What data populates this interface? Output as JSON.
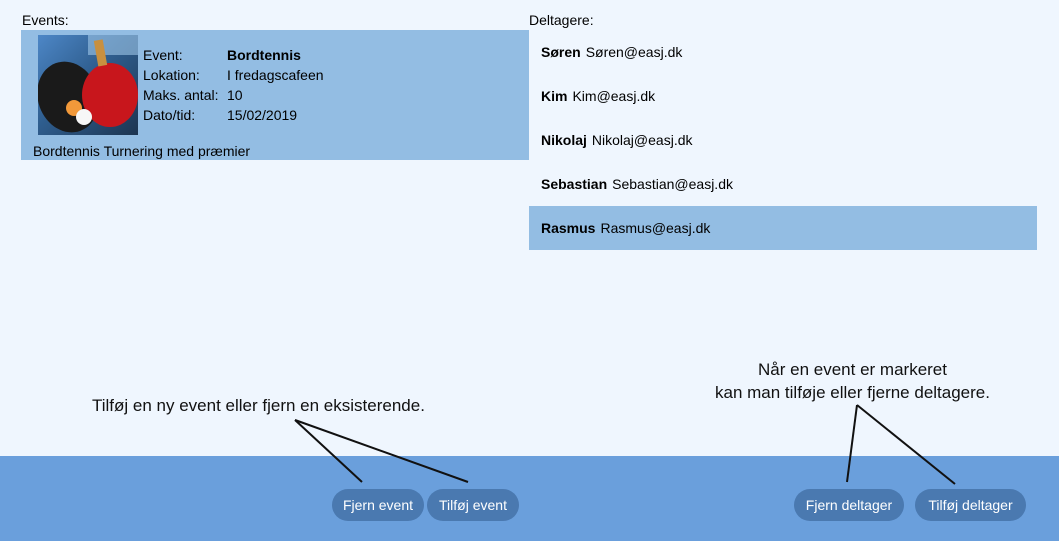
{
  "events_section": {
    "header": "Events:",
    "selected_event": {
      "labels": {
        "event": "Event:",
        "location": "Lokation:",
        "max_count": "Maks. antal:",
        "datetime": "Dato/tid:"
      },
      "name": "Bordtennis",
      "location": "I fredagscafeen",
      "max_count": "10",
      "datetime": "15/02/2019",
      "description": "Bordtennis Turnering med præmier"
    }
  },
  "participants_section": {
    "header": "Deltagere:",
    "items": [
      {
        "name": "Søren",
        "email": "Søren@easj.dk"
      },
      {
        "name": "Kim",
        "email": "Kim@easj.dk"
      },
      {
        "name": "Nikolaj",
        "email": "Nikolaj@easj.dk"
      },
      {
        "name": "Sebastian",
        "email": "Sebastian@easj.dk"
      },
      {
        "name": "Rasmus",
        "email": "Rasmus@easj.dk",
        "selected": true
      }
    ]
  },
  "annotations": {
    "left": "Tilføj en ny event eller fjern en eksisterende.",
    "right_line1": "Når en event er markeret",
    "right_line2": "kan man tilføje eller fjerne deltagere."
  },
  "buttons": {
    "remove_event": "Fjern event",
    "add_event": "Tilføj event",
    "remove_participant": "Fjern deltager",
    "add_participant": "Tilføj deltager"
  },
  "colors": {
    "background": "#eff6fe",
    "selection": "#93bde3",
    "bottom_bar": "#6a9fdc",
    "button": "#4a79b0"
  }
}
